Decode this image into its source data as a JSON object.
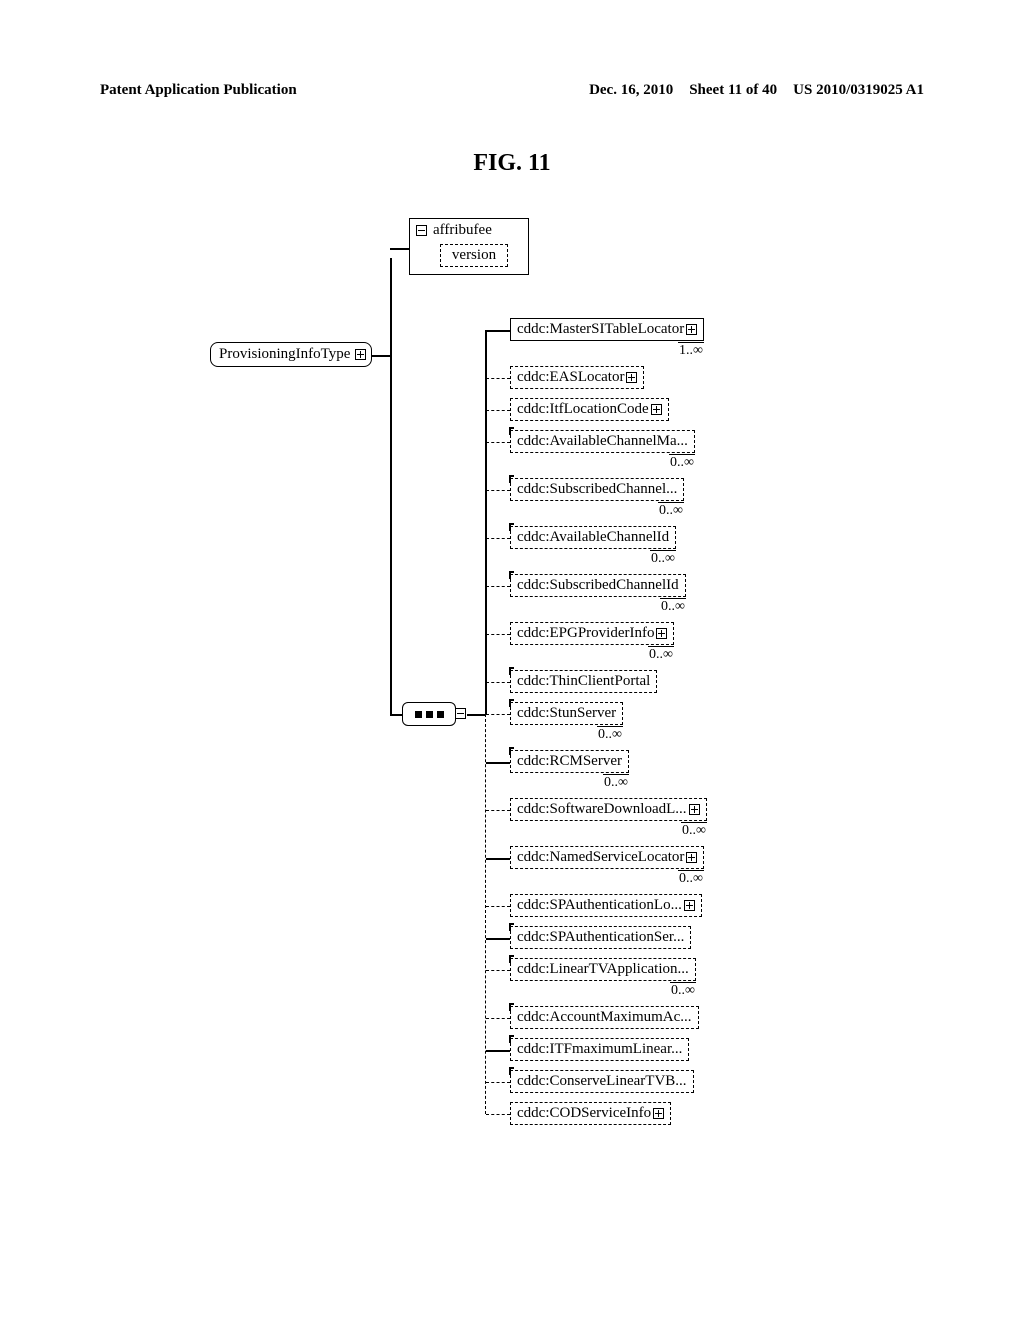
{
  "header": {
    "left": "Patent Application Publication",
    "date": "Dec. 16, 2010",
    "sheet": "Sheet 11 of 40",
    "pubnum": "US 2010/0319025 A1"
  },
  "figure_title": "FIG. 11",
  "root": {
    "label": "ProvisioningInfoType"
  },
  "attribute_box": {
    "header": "affribufee",
    "item": "version"
  },
  "children": [
    {
      "label": "cddc:MasterSITableLocator",
      "optional": false,
      "expand": true,
      "cardinality": "1..∞",
      "corner": false,
      "dashed_conn": false
    },
    {
      "label": "cddc:EASLocator",
      "optional": true,
      "expand": true,
      "cardinality": "",
      "corner": false,
      "dashed_conn": true
    },
    {
      "label": "cddc:ItfLocationCode",
      "optional": true,
      "expand": true,
      "cardinality": "",
      "corner": false,
      "dashed_conn": true
    },
    {
      "label": "cddc:AvailableChannelMa...",
      "optional": true,
      "expand": false,
      "cardinality": "0..∞",
      "corner": true,
      "dashed_conn": true
    },
    {
      "label": "cddc:SubscribedChannel...",
      "optional": true,
      "expand": false,
      "cardinality": "0..∞",
      "corner": true,
      "dashed_conn": true
    },
    {
      "label": "cddc:AvailableChannelId",
      "optional": true,
      "expand": false,
      "cardinality": "0..∞",
      "corner": true,
      "dashed_conn": true
    },
    {
      "label": "cddc:SubscribedChannelId",
      "optional": true,
      "expand": false,
      "cardinality": "0..∞",
      "corner": true,
      "dashed_conn": true
    },
    {
      "label": "cddc:EPGProviderInfo",
      "optional": true,
      "expand": true,
      "cardinality": "0..∞",
      "corner": false,
      "dashed_conn": true
    },
    {
      "label": "cddc:ThinClientPortal",
      "optional": true,
      "expand": false,
      "cardinality": "",
      "corner": true,
      "dashed_conn": true
    },
    {
      "label": "cddc:StunServer",
      "optional": true,
      "expand": false,
      "cardinality": "0..∞",
      "corner": true,
      "dashed_conn": true
    },
    {
      "label": "cddc:RCMServer",
      "optional": true,
      "expand": false,
      "cardinality": "0..∞",
      "corner": true,
      "dashed_conn": false
    },
    {
      "label": "cddc:SoftwareDownloadL...",
      "optional": true,
      "expand": true,
      "cardinality": "0..∞",
      "corner": false,
      "dashed_conn": true
    },
    {
      "label": "cddc:NamedServiceLocator",
      "optional": true,
      "expand": true,
      "cardinality": "0..∞",
      "corner": false,
      "dashed_conn": false
    },
    {
      "label": "cddc:SPAuthenticationLo...",
      "optional": true,
      "expand": true,
      "cardinality": "",
      "corner": false,
      "dashed_conn": true
    },
    {
      "label": "cddc:SPAuthenticationSer...",
      "optional": true,
      "expand": false,
      "cardinality": "",
      "corner": true,
      "dashed_conn": false
    },
    {
      "label": "cddc:LinearTVApplication...",
      "optional": true,
      "expand": false,
      "cardinality": "0..∞",
      "corner": true,
      "dashed_conn": true
    },
    {
      "label": "cddc:AccountMaximumAc...",
      "optional": true,
      "expand": false,
      "cardinality": "",
      "corner": true,
      "dashed_conn": true
    },
    {
      "label": "cddc:ITFmaximumLinear...",
      "optional": true,
      "expand": false,
      "cardinality": "",
      "corner": true,
      "dashed_conn": false
    },
    {
      "label": "cddc:ConserveLinearTVB...",
      "optional": true,
      "expand": false,
      "cardinality": "",
      "corner": true,
      "dashed_conn": true
    },
    {
      "label": "cddc:CODServiceInfo",
      "optional": true,
      "expand": true,
      "cardinality": "",
      "corner": false,
      "dashed_conn": true
    }
  ],
  "page_number": ""
}
